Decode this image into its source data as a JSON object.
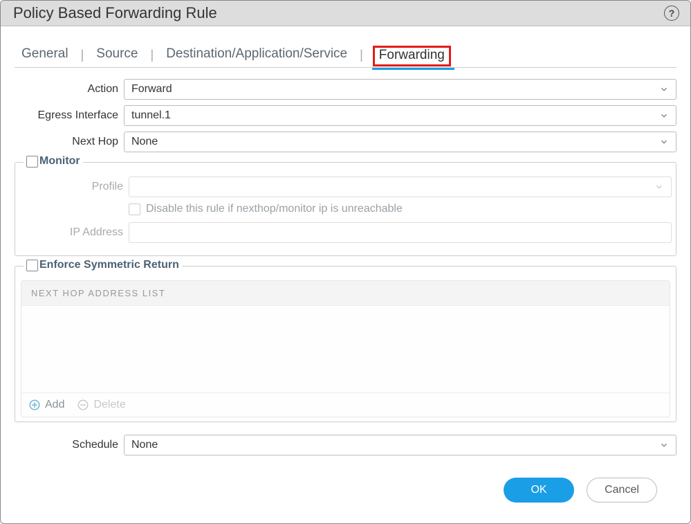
{
  "window": {
    "title": "Policy Based Forwarding Rule"
  },
  "tabs": {
    "general": "General",
    "source": "Source",
    "destination": "Destination/Application/Service",
    "forwarding": "Forwarding",
    "active": "forwarding"
  },
  "fields": {
    "action": {
      "label": "Action",
      "value": "Forward"
    },
    "egress": {
      "label": "Egress Interface",
      "value": "tunnel.1"
    },
    "nexthop": {
      "label": "Next Hop",
      "value": "None"
    },
    "schedule": {
      "label": "Schedule",
      "value": "None"
    }
  },
  "monitor": {
    "legend": "Monitor",
    "checked": false,
    "profile_label": "Profile",
    "disable_label": "Disable this rule if nexthop/monitor ip is unreachable",
    "ip_label": "IP Address"
  },
  "symmetric": {
    "legend": "Enforce Symmetric Return",
    "checked": false,
    "list_header": "NEXT HOP ADDRESS LIST",
    "add_label": "Add",
    "delete_label": "Delete"
  },
  "buttons": {
    "ok": "OK",
    "cancel": "Cancel"
  }
}
